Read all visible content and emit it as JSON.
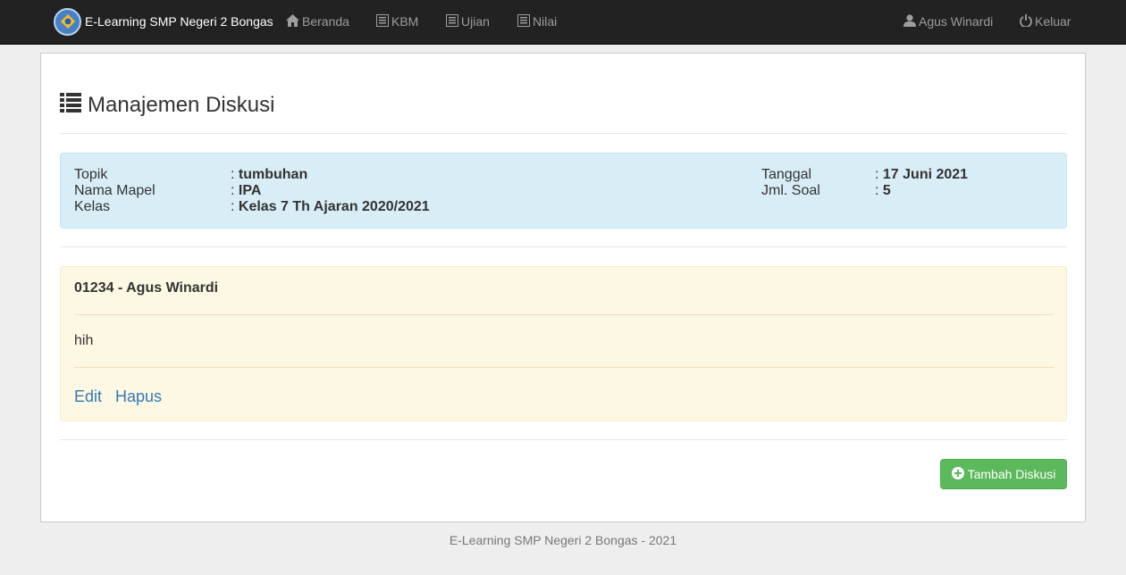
{
  "navbar": {
    "brand": "E-Learning SMP Negeri 2 Bongas",
    "menu": {
      "beranda": "Beranda",
      "kbm": "KBM",
      "ujian": "Ujian",
      "nilai": "Nilai"
    },
    "user_name": "Agus Winardi",
    "logout": "Keluar"
  },
  "page": {
    "title": "Manajemen Diskusi"
  },
  "info": {
    "topik_label": "Topik",
    "topik_value": "tumbuhan",
    "mapel_label": "Nama Mapel",
    "mapel_value": "IPA",
    "kelas_label": "Kelas",
    "kelas_value": "Kelas 7 Th Ajaran 2020/2021",
    "tanggal_label": "Tanggal",
    "tanggal_value": "17 Juni 2021",
    "soal_label": "Jml. Soal",
    "soal_value": "5",
    "separator": ":"
  },
  "discussion": {
    "author": "01234 - Agus Winardi",
    "body": "hih",
    "edit_label": "Edit",
    "hapus_label": "Hapus"
  },
  "actions": {
    "add_label": "Tambah Diskusi"
  },
  "footer": {
    "text": "E-Learning SMP Negeri 2 Bongas - 2021"
  },
  "colors": {
    "navbar_bg": "#222222",
    "info_bg": "#d9edf7",
    "discussion_bg": "#fcf8e3",
    "link": "#337ab7",
    "success": "#5cb85c"
  },
  "icons": {
    "brand": "tut-wuri-logo-icon",
    "beranda": "home-icon",
    "kbm": "list-alt-icon",
    "ujian": "list-alt-icon",
    "nilai": "list-alt-icon",
    "user": "user-icon",
    "logout": "power-icon",
    "title": "list-icon",
    "add": "plus-circle-icon"
  }
}
